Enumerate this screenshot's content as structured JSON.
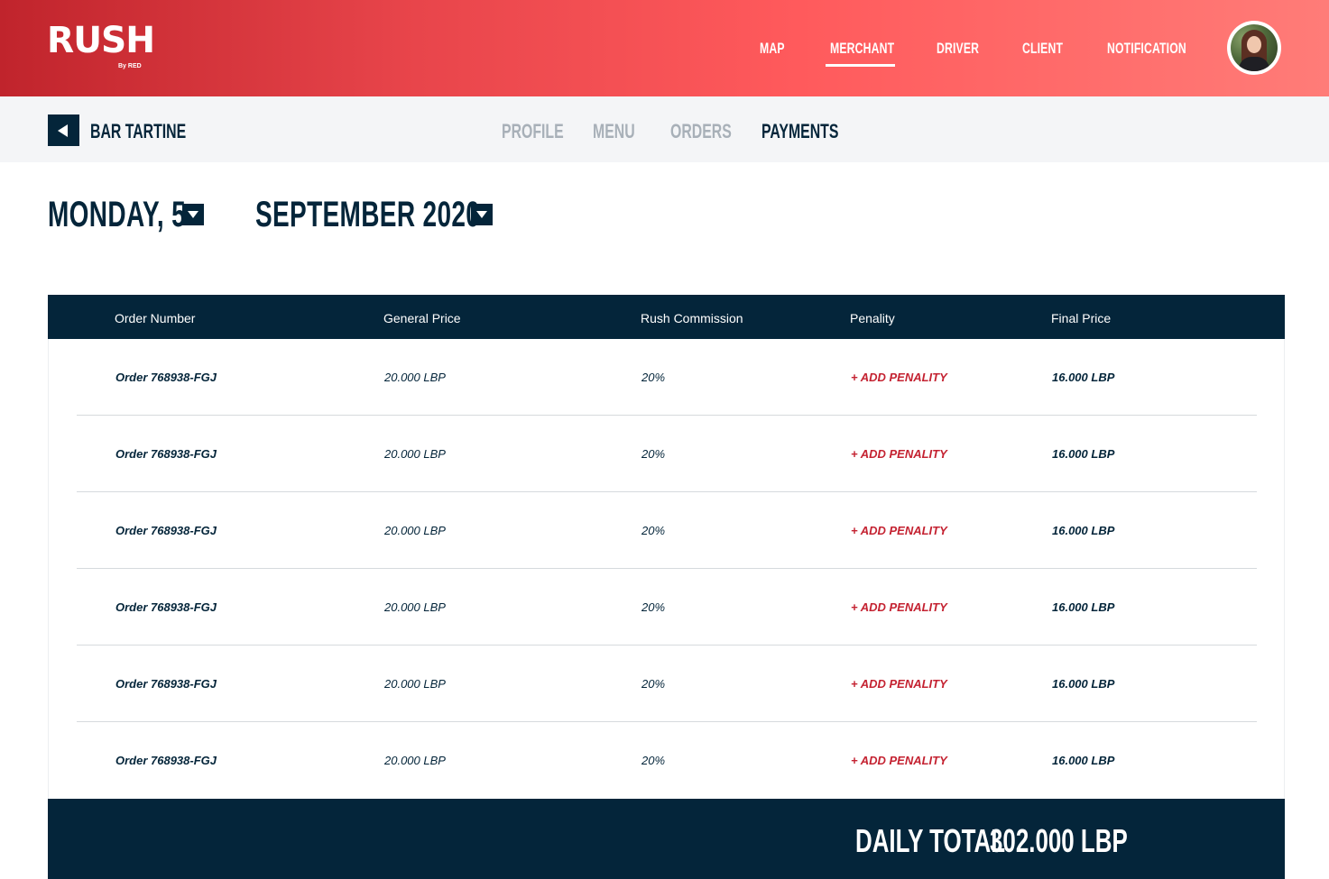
{
  "brand": {
    "name": "RUSH",
    "sub": "By RED",
    "primary": "#e7444a",
    "dark": "#04253a",
    "accent_red": "#c42231"
  },
  "nav": {
    "items": [
      {
        "label": "MAP"
      },
      {
        "label": "MERCHANT",
        "active": true
      },
      {
        "label": "DRIVER"
      },
      {
        "label": "CLIENT"
      },
      {
        "label": "NOTIFICATION"
      }
    ]
  },
  "merchant": {
    "name": "BAR TARTINE"
  },
  "tabs": [
    {
      "label": "PROFILE"
    },
    {
      "label": "MENU"
    },
    {
      "label": "ORDERS"
    },
    {
      "label": "PAYMENTS",
      "active": true
    }
  ],
  "date": {
    "day": "MONDAY, 5",
    "month": "SEPTEMBER 2020"
  },
  "table": {
    "headers": [
      "Order Number",
      "General Price",
      "Rush Commission",
      "Penality",
      "Final Price"
    ],
    "rows": [
      {
        "order": "Order 768938-FGJ",
        "general": "20.000 LBP",
        "commission": "20%",
        "penalty": "+ ADD PENALITY",
        "final": "16.000 LBP"
      },
      {
        "order": "Order 768938-FGJ",
        "general": "20.000 LBP",
        "commission": "20%",
        "penalty": "+ ADD PENALITY",
        "final": "16.000 LBP"
      },
      {
        "order": "Order 768938-FGJ",
        "general": "20.000 LBP",
        "commission": "20%",
        "penalty": "+ ADD PENALITY",
        "final": "16.000 LBP"
      },
      {
        "order": "Order 768938-FGJ",
        "general": "20.000 LBP",
        "commission": "20%",
        "penalty": "+ ADD PENALITY",
        "final": "16.000 LBP"
      },
      {
        "order": "Order 768938-FGJ",
        "general": "20.000 LBP",
        "commission": "20%",
        "penalty": "+ ADD PENALITY",
        "final": "16.000 LBP"
      },
      {
        "order": "Order 768938-FGJ",
        "general": "20.000 LBP",
        "commission": "20%",
        "penalty": "+ ADD PENALITY",
        "final": "16.000 LBP"
      }
    ]
  },
  "totals": {
    "label": "DAILY TOTAL",
    "value": "302.000 LBP"
  },
  "icons": {
    "back": "back-arrow-icon",
    "dropdown": "caret-down-icon",
    "avatar": "user-avatar"
  }
}
